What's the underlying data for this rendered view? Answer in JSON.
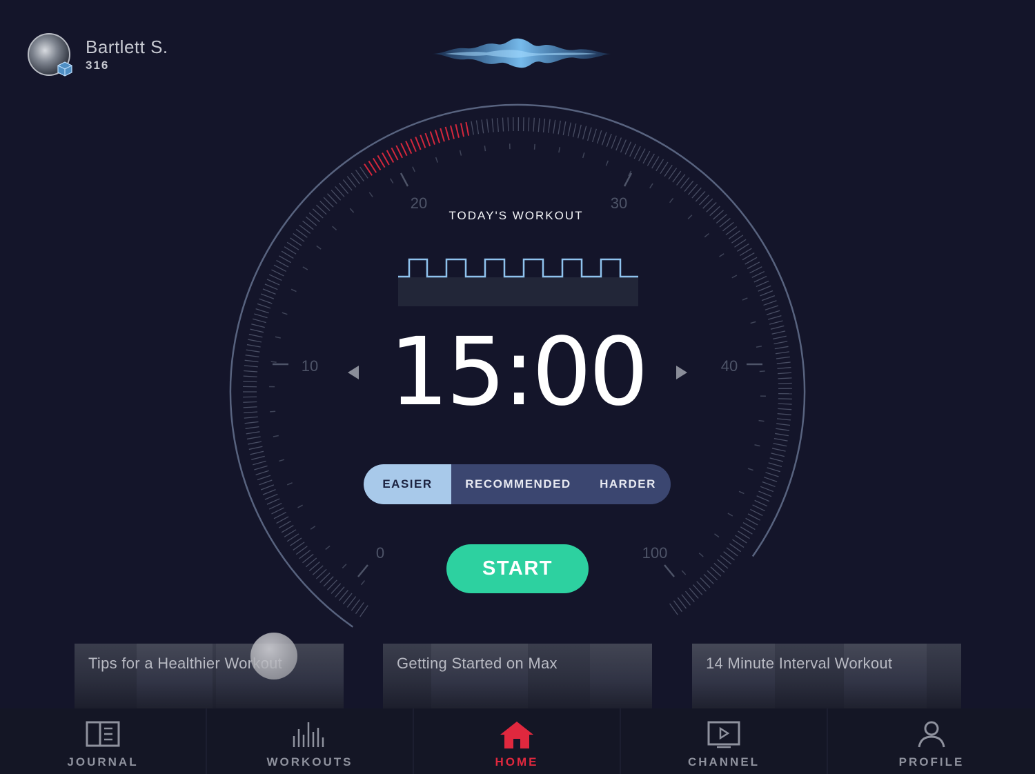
{
  "user": {
    "name": "Bartlett S.",
    "score": "316",
    "avatar_icon": "avatar-badge-cube-icon"
  },
  "voice_icon": "voice-wave-icon",
  "gauge": {
    "tick_labels": [
      "0",
      "10",
      "20",
      "30",
      "40",
      "100"
    ],
    "accent_color": "#e0283e",
    "ring_color": "#6b7590"
  },
  "workout": {
    "title": "TODAY'S WORKOUT",
    "timer": "15:00",
    "prev_icon": "chevron-left-icon",
    "next_icon": "chevron-right-icon"
  },
  "difficulty": {
    "options": [
      "EASIER",
      "RECOMMENDED",
      "HARDER"
    ],
    "selected": "EASIER"
  },
  "start_label": "START",
  "cards": [
    {
      "title": "Tips for a Healthier Workout"
    },
    {
      "title": "Getting Started on Max"
    },
    {
      "title": "14 Minute Interval Workout"
    }
  ],
  "tabs": [
    {
      "label": "JOURNAL",
      "icon": "journal-icon"
    },
    {
      "label": "WORKOUTS",
      "icon": "workouts-icon"
    },
    {
      "label": "HOME",
      "icon": "home-icon"
    },
    {
      "label": "CHANNEL",
      "icon": "channel-icon"
    },
    {
      "label": "PROFILE",
      "icon": "profile-icon"
    }
  ],
  "active_tab": "HOME",
  "colors": {
    "background": "#14152a",
    "start": "#2dd1a0",
    "selected_segment": "#a8c9ea",
    "segment_bg": "#3b4670",
    "active_tab": "#e0283e"
  }
}
